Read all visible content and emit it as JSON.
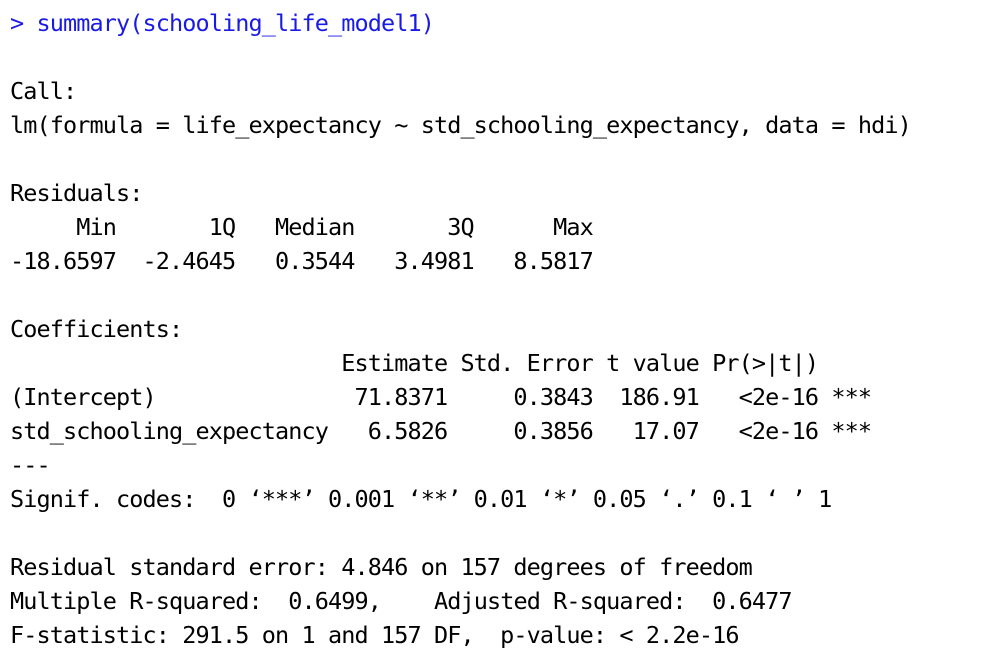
{
  "console": {
    "lines": [
      {
        "text": "> summary(schooling_life_model1)",
        "kind": "command"
      },
      {
        "text": "",
        "kind": "output"
      },
      {
        "text": "Call:",
        "kind": "output"
      },
      {
        "text": "lm(formula = life_expectancy ~ std_schooling_expectancy, data = hdi)",
        "kind": "output"
      },
      {
        "text": "",
        "kind": "output"
      },
      {
        "text": "Residuals:",
        "kind": "output"
      },
      {
        "text": "     Min       1Q   Median       3Q      Max ",
        "kind": "output"
      },
      {
        "text": "-18.6597  -2.4645   0.3544   3.4981   8.5817 ",
        "kind": "output"
      },
      {
        "text": "",
        "kind": "output"
      },
      {
        "text": "Coefficients:",
        "kind": "output"
      },
      {
        "text": "                         Estimate Std. Error t value Pr(>|t|)    ",
        "kind": "output"
      },
      {
        "text": "(Intercept)               71.8371     0.3843  186.91   <2e-16 ***",
        "kind": "output"
      },
      {
        "text": "std_schooling_expectancy   6.5826     0.3856   17.07   <2e-16 ***",
        "kind": "output"
      },
      {
        "text": "---",
        "kind": "output"
      },
      {
        "text": "Signif. codes:  0 ‘***’ 0.001 ‘**’ 0.01 ‘*’ 0.05 ‘.’ 0.1 ‘ ’ 1",
        "kind": "output"
      },
      {
        "text": "",
        "kind": "output"
      },
      {
        "text": "Residual standard error: 4.846 on 157 degrees of freedom",
        "kind": "output"
      },
      {
        "text": "Multiple R-squared:  0.6499,\tAdjusted R-squared:  0.6477 ",
        "kind": "output"
      },
      {
        "text": "F-statistic: 291.5 on 1 and 157 DF,  p-value: < 2.2e-16",
        "kind": "output"
      }
    ]
  },
  "colors": {
    "command": "#1a1ae6",
    "output": "#000000",
    "background": "#ffffff"
  }
}
